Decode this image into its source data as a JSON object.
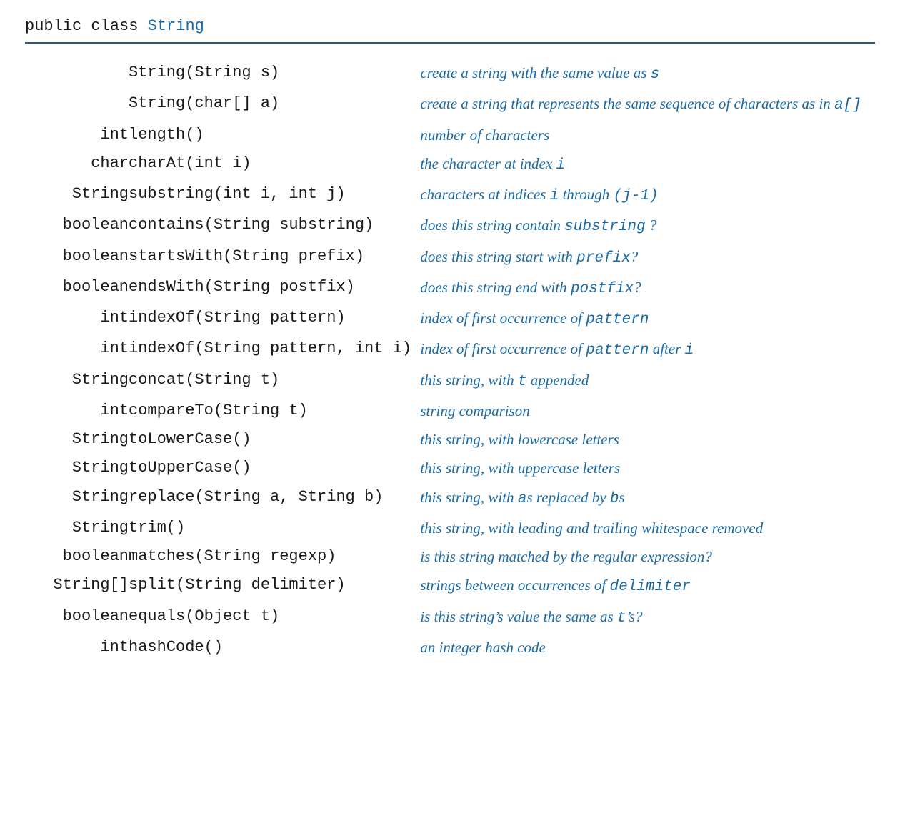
{
  "header": {
    "keywords": "public class ",
    "classname": "String"
  },
  "rows": [
    {
      "ret": "",
      "sig": "String(String s)",
      "desc": [
        {
          "t": "create a string with the same value as "
        },
        {
          "t": "s",
          "code": true
        }
      ]
    },
    {
      "ret": "",
      "sig": "String(char[] a)",
      "desc": [
        {
          "t": "create a string that represents the same sequence of characters as in "
        },
        {
          "t": "a[]",
          "code": true
        }
      ]
    },
    {
      "ret": "int",
      "sig": "length()",
      "desc": [
        {
          "t": "number of characters"
        }
      ]
    },
    {
      "ret": "char",
      "sig": "charAt(int i)",
      "desc": [
        {
          "t": "the character at index "
        },
        {
          "t": "i",
          "code": true
        }
      ]
    },
    {
      "ret": "String",
      "sig": "substring(int i, int j)",
      "desc": [
        {
          "t": "characters at indices "
        },
        {
          "t": "i",
          "code": true
        },
        {
          "t": " through "
        },
        {
          "t": "(j-1)",
          "code": true
        }
      ]
    },
    {
      "ret": "boolean",
      "sig": "contains(String substring)",
      "desc": [
        {
          "t": "does this string contain "
        },
        {
          "t": "substring",
          "code": true
        },
        {
          "t": " ?"
        }
      ]
    },
    {
      "ret": "boolean",
      "sig": "startsWith(String prefix)",
      "desc": [
        {
          "t": "does this string start with "
        },
        {
          "t": "prefix",
          "code": true
        },
        {
          "t": "?"
        }
      ]
    },
    {
      "ret": "boolean",
      "sig": "endsWith(String postfix)",
      "desc": [
        {
          "t": "does this string end with "
        },
        {
          "t": "postfix",
          "code": true
        },
        {
          "t": "?"
        }
      ]
    },
    {
      "ret": "int",
      "sig": "indexOf(String pattern)",
      "desc": [
        {
          "t": "index of first occurrence of "
        },
        {
          "t": "pattern",
          "code": true
        }
      ]
    },
    {
      "ret": "int",
      "sig": "indexOf(String pattern, int i)",
      "desc": [
        {
          "t": "index of first occurrence of "
        },
        {
          "t": "pattern",
          "code": true
        },
        {
          "t": " after "
        },
        {
          "t": "i",
          "code": true
        }
      ]
    },
    {
      "ret": "String",
      "sig": "concat(String t)",
      "desc": [
        {
          "t": "this string, with "
        },
        {
          "t": "t",
          "code": true
        },
        {
          "t": " appended"
        }
      ]
    },
    {
      "ret": "int",
      "sig": "compareTo(String t)",
      "desc": [
        {
          "t": "string comparison"
        }
      ]
    },
    {
      "ret": "String",
      "sig": "toLowerCase()",
      "desc": [
        {
          "t": "this string, with lowercase letters"
        }
      ]
    },
    {
      "ret": "String",
      "sig": "toUpperCase()",
      "desc": [
        {
          "t": "this string, with uppercase letters"
        }
      ]
    },
    {
      "ret": "String",
      "sig": "replace(String a, String b)",
      "desc": [
        {
          "t": "this string, with "
        },
        {
          "t": "a",
          "code": true
        },
        {
          "t": "s replaced by "
        },
        {
          "t": "b",
          "code": true
        },
        {
          "t": "s"
        }
      ]
    },
    {
      "ret": "String",
      "sig": "trim()",
      "desc": [
        {
          "t": "this string, with leading and trailing whitespace removed"
        }
      ]
    },
    {
      "ret": "boolean",
      "sig": "matches(String regexp)",
      "desc": [
        {
          "t": "is this string matched by the regular expression?"
        }
      ]
    },
    {
      "ret": "String[]",
      "sig": "split(String delimiter)",
      "desc": [
        {
          "t": "strings between occurrences of "
        },
        {
          "t": "delimiter",
          "code": true
        }
      ]
    },
    {
      "ret": "boolean",
      "sig": "equals(Object t)",
      "desc": [
        {
          "t": "is this string’s value the same as "
        },
        {
          "t": "t",
          "code": true
        },
        {
          "t": "’s?"
        }
      ]
    },
    {
      "ret": "int",
      "sig": "hashCode()",
      "desc": [
        {
          "t": "an integer hash code"
        }
      ]
    }
  ]
}
